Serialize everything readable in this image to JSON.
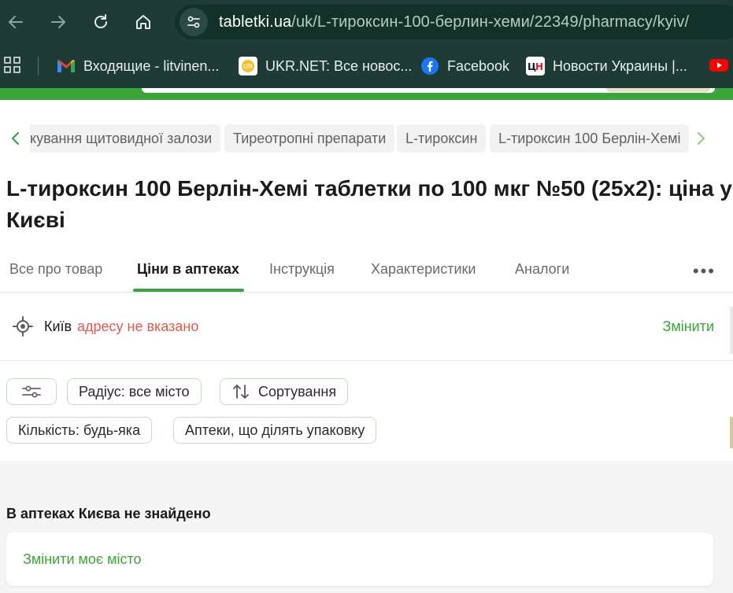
{
  "browser": {
    "url_host": "tabletki.ua",
    "url_path": "/uk/L-тироксин-100-берлин-хеми/22349/pharmacy/kyiv/",
    "bookmarks": [
      {
        "label": "Входящие - litvinen...",
        "icon": "gmail-icon"
      },
      {
        "label": "UKR.NET: Все новос...",
        "icon": "ukrnet-icon"
      },
      {
        "label": "Facebook",
        "icon": "facebook-icon"
      },
      {
        "label": "Новости Украины |...",
        "icon": "tsn-icon"
      }
    ]
  },
  "breadcrumbs": [
    "кування щитовидної залози",
    "Тиреотропні препарати",
    "L-тироксин",
    "L-тироксин 100 Берлін-Хемі"
  ],
  "page": {
    "title": "L-тироксин 100 Берлін-Хемі таблетки по 100 мкг №50 (25х2): ціна у Києві"
  },
  "tabs": [
    {
      "label": "Все про товар",
      "active": false
    },
    {
      "label": "Ціни в аптеках",
      "active": true
    },
    {
      "label": "Інструкція",
      "active": false
    },
    {
      "label": "Характеристики",
      "active": false
    },
    {
      "label": "Аналоги",
      "active": false
    }
  ],
  "more_label": "•••",
  "location": {
    "city": "Київ",
    "address": "адресу не вказано",
    "change_label": "Змінити"
  },
  "filters": {
    "radius": "Радіус: все місто",
    "sort": "Сортування",
    "quantity": "Кількість: будь-яка",
    "split": "Аптеки, що ділять упаковку"
  },
  "results": {
    "empty_message": "В аптеках Києва не знайдено",
    "change_city_label": "Змінити моє місто"
  },
  "colors": {
    "accent": "#3aa539",
    "warning": "#e05a52",
    "chrome_bg": "#1f3b36"
  }
}
